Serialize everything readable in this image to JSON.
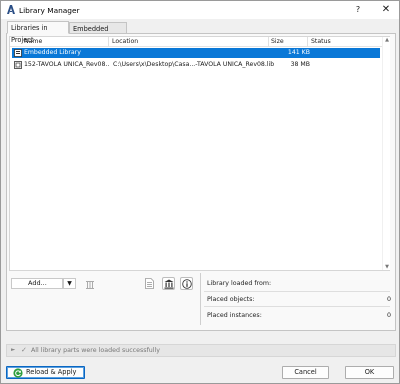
{
  "window": {
    "title": "Library Manager",
    "help_label": "?",
    "close_label": "✕",
    "icon": "archicad-logo-icon"
  },
  "tabs": [
    {
      "label": "Libraries in Project",
      "active": true
    },
    {
      "label": "Embedded Library",
      "active": false
    }
  ],
  "table": {
    "columns": [
      "Name",
      "Location",
      "Size",
      "Status"
    ],
    "rows": [
      {
        "name": "Embedded Library",
        "location": "",
        "size": "141 KB",
        "status": "",
        "selected": true,
        "icon": "embedded-library-icon"
      },
      {
        "name": "152-TAVOLA UNICA_Rev08....",
        "location": "C:\\Users\\x\\Desktop\\Casa...-TAVOLA UNICA_Rev08.lib",
        "size": "38 MB",
        "status": "",
        "selected": false,
        "icon": "linked-library-icon"
      }
    ]
  },
  "toolbar": {
    "add_label": "Add...",
    "add_arrow": "▼"
  },
  "info": {
    "loaded_from_label": "Library loaded from:",
    "placed_objects_label": "Placed objects:",
    "placed_objects_value": "0",
    "placed_instances_label": "Placed instances:",
    "placed_instances_value": "0"
  },
  "status": {
    "expand_glyph": "►",
    "check_glyph": "✓",
    "text": "All library parts were loaded successfully"
  },
  "buttons": {
    "reload_apply": "Reload & Apply",
    "cancel": "Cancel",
    "ok": "OK"
  },
  "colors": {
    "selection": "#0a78d7",
    "primary_border": "#0a66c2"
  }
}
